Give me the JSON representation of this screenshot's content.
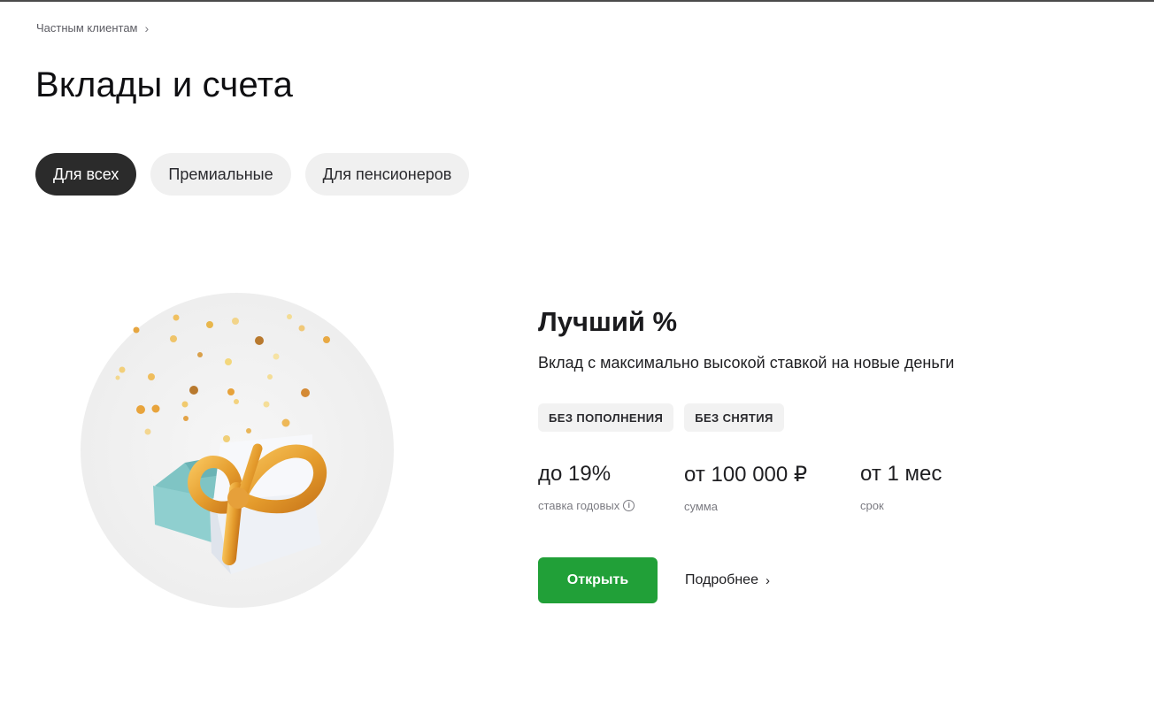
{
  "breadcrumb": {
    "label": "Частным клиентам",
    "chevron": "›"
  },
  "page": {
    "title": "Вклады и счета"
  },
  "tabs": [
    {
      "label": "Для всех",
      "active": true
    },
    {
      "label": "Премиальные",
      "active": false
    },
    {
      "label": "Для пенсионеров",
      "active": false
    }
  ],
  "product": {
    "title": "Лучший %",
    "description": "Вклад с максимально высокой ставкой на новые деньги",
    "badges": [
      "БЕЗ ПОПОЛНЕНИЯ",
      "БЕЗ СНЯТИЯ"
    ],
    "stats": [
      {
        "value": "до 19%",
        "label": "ставка годовых"
      },
      {
        "value": "от 100 000 ₽",
        "label": "сумма"
      },
      {
        "value": "от 1 мес",
        "label": "срок"
      }
    ],
    "info_icon": "i",
    "open_button": "Открыть",
    "more_link": "Подробнее",
    "more_chevron": "›"
  },
  "colors": {
    "accent": "#21a038",
    "tab_active": "#2b2b2b",
    "tab_inactive": "#f0f0f0"
  },
  "icons": {
    "breadcrumb": "chevron-right-icon",
    "info": "info-icon",
    "more": "chevron-right-icon"
  }
}
